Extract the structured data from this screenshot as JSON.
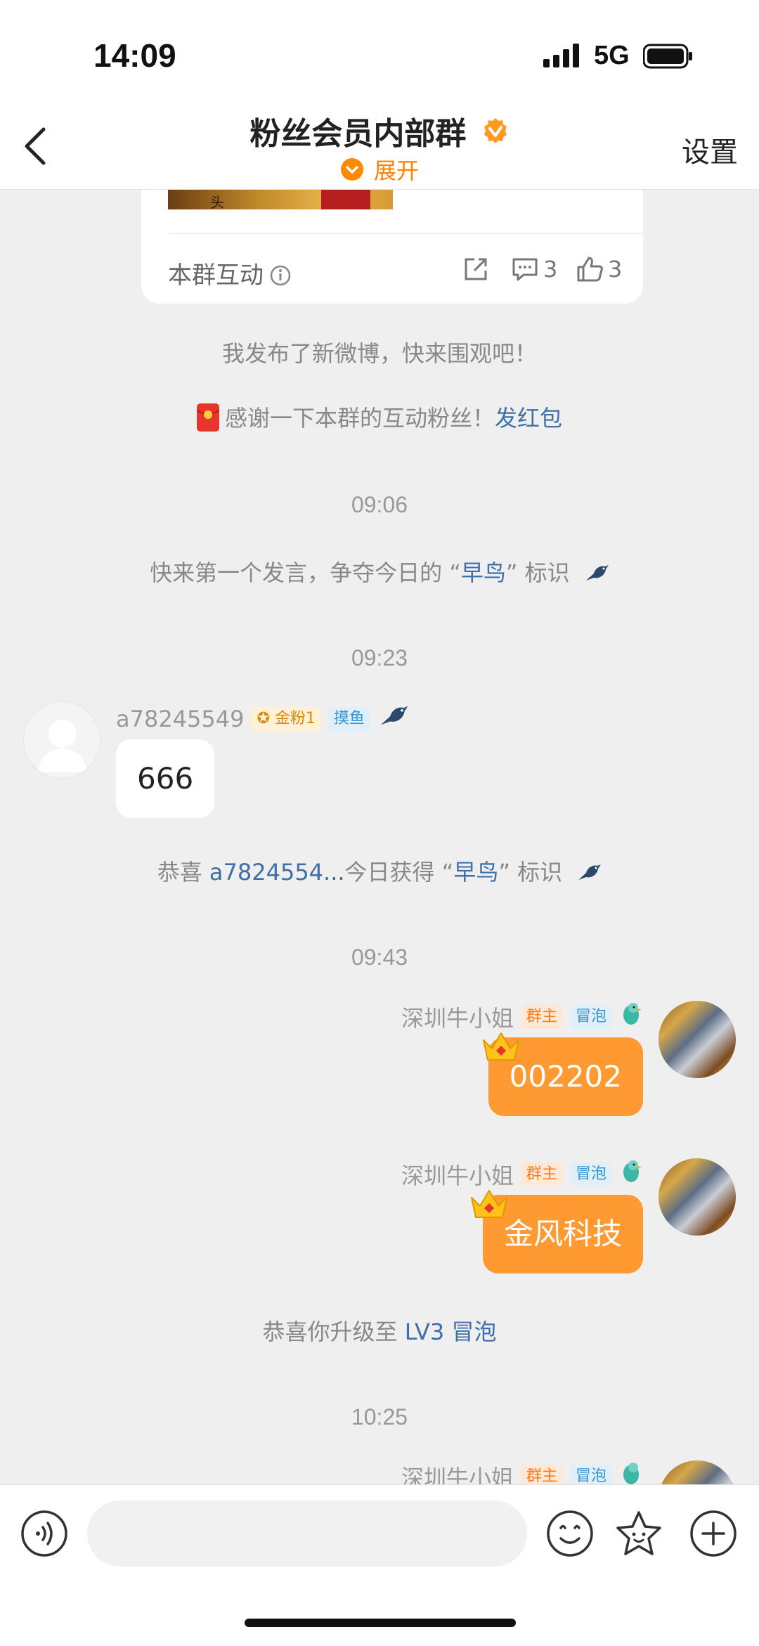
{
  "status_bar": {
    "time": "14:09",
    "network": "5G"
  },
  "nav": {
    "title": "粉丝会员内部群",
    "expand_label": "展开",
    "settings_label": "设置"
  },
  "card": {
    "label": "本群互动",
    "comments": "3",
    "likes": "3",
    "image_text": "头"
  },
  "messages": {
    "sys_new_weibo": "我发布了新微博，快来围观吧！",
    "sys_thanks_prefix": "感谢一下本群的互动粉丝！",
    "sys_thanks_link": "发红包",
    "ts1": "09:06",
    "sys_early_prefix": "快来第一个发言，争夺今日的 “",
    "sys_early_hl": "早鸟",
    "sys_early_suffix": "” 标识",
    "ts2": "09:23",
    "msg1": {
      "sender": "a78245549",
      "tag1": "金粉1",
      "tag2": "摸鱼",
      "text": "666"
    },
    "sys_congrats_prefix": "恭喜 ",
    "sys_congrats_user": "a7824554...",
    "sys_congrats_mid": "今日获得 “",
    "sys_congrats_hl": "早鸟",
    "sys_congrats_suffix": "” 标识",
    "ts3": "09:43",
    "msg2": {
      "sender": "深圳牛小姐",
      "tag1": "群主",
      "tag2": "冒泡",
      "text": "002202"
    },
    "msg3": {
      "sender": "深圳牛小姐",
      "tag1": "群主",
      "tag2": "冒泡",
      "text": "金风科技"
    },
    "sys_level_prefix": "恭喜你升级至 ",
    "sys_level_hl": "LV3 冒泡",
    "ts4": "10:25",
    "msg4": {
      "sender": "深圳牛小姐",
      "tag1": "群主",
      "tag2": "冒泡"
    }
  },
  "input": {
    "placeholder": ""
  },
  "colors": {
    "accent": "#ff8200",
    "bubble_self": "#ff9a33",
    "link": "#3e6fa6",
    "background": "#efefef"
  },
  "icons": [
    "back-icon",
    "verified-icon",
    "chevron-down-icon",
    "info-icon",
    "share-icon",
    "comment-icon",
    "like-icon",
    "red-packet-icon",
    "bird-icon",
    "crown-icon",
    "voice-icon",
    "emoji-icon",
    "sticker-icon",
    "plus-icon"
  ]
}
